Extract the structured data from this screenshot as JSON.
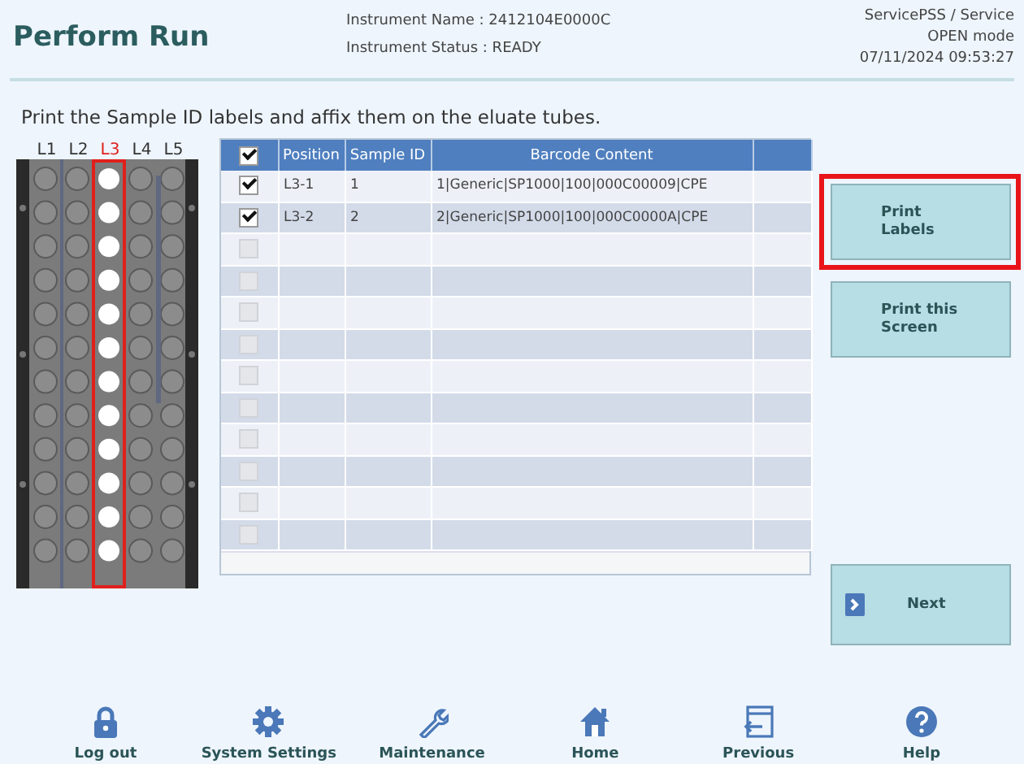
{
  "header": {
    "title": "Perform Run",
    "instrument_name": "Instrument Name : 2412104E0000C",
    "instrument_status": "Instrument Status : READY",
    "user": "ServicePSS / Service",
    "mode": "OPEN mode",
    "datetime": "07/11/2024 09:53:27"
  },
  "instruction": "Print the Sample ID labels and affix them on the eluate tubes.",
  "rack": {
    "lanes": [
      {
        "label": "L1",
        "selected": false
      },
      {
        "label": "L2",
        "selected": false
      },
      {
        "label": "L3",
        "selected": true
      },
      {
        "label": "L4",
        "selected": false
      },
      {
        "label": "L5",
        "selected": false
      }
    ]
  },
  "table": {
    "all_checked": true,
    "columns": [
      "Position",
      "Sample ID",
      "Barcode Content"
    ],
    "rows": [
      {
        "checked": true,
        "cells": [
          "L3-1",
          "1",
          "1|Generic|SP1000|100|000C00009|CPE"
        ]
      },
      {
        "checked": true,
        "cells": [
          "L3-2",
          "2",
          "2|Generic|SP1000|100|000C0000A|CPE"
        ]
      },
      {
        "checked": false,
        "cells": []
      },
      {
        "checked": false,
        "cells": []
      },
      {
        "checked": false,
        "cells": []
      },
      {
        "checked": false,
        "cells": []
      },
      {
        "checked": false,
        "cells": []
      },
      {
        "checked": false,
        "cells": []
      },
      {
        "checked": false,
        "cells": []
      },
      {
        "checked": false,
        "cells": []
      },
      {
        "checked": false,
        "cells": []
      },
      {
        "checked": false,
        "cells": []
      }
    ]
  },
  "actions": [
    {
      "kind": "print",
      "label": "Print\nLabels",
      "highlighted": true
    },
    {
      "kind": "print",
      "label": "Print this\nScreen",
      "highlighted": false
    },
    {
      "kind": "next",
      "label": "Next",
      "highlighted": false
    }
  ],
  "footer": [
    {
      "kind": "lock",
      "label": "Log out"
    },
    {
      "kind": "gear",
      "label": "System Settings"
    },
    {
      "kind": "wrench",
      "label": "Maintenance"
    },
    {
      "kind": "home",
      "label": "Home"
    },
    {
      "kind": "back",
      "label": "Previous"
    },
    {
      "kind": "help",
      "label": "Help"
    }
  ]
}
